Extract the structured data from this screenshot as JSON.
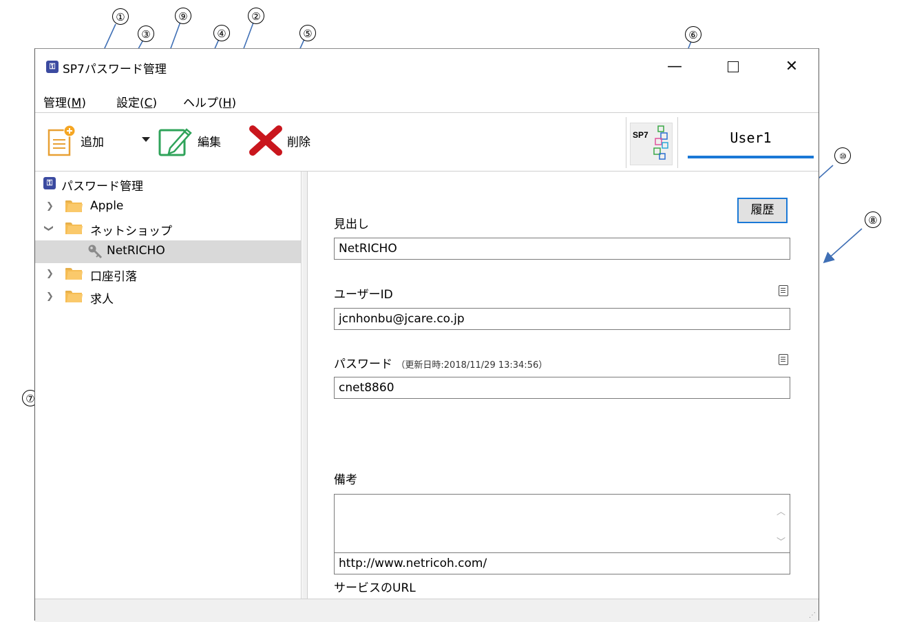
{
  "window": {
    "title": "SP7パスワード管理",
    "app_icon": "password-manager-icon",
    "minimize_icon": "—",
    "close_icon": "✕"
  },
  "menu": {
    "items": [
      {
        "label": "管理(",
        "key": "M",
        "end": ")"
      },
      {
        "label": "設定(",
        "key": "C",
        "end": ")"
      },
      {
        "label": "ヘルプ(",
        "key": "H",
        "end": ")"
      }
    ]
  },
  "toolbar": {
    "add_label": "追加",
    "edit_label": "編集",
    "delete_label": "削除",
    "logo_text": "SP7",
    "user_name": "User1"
  },
  "tree": {
    "root": "パスワード管理",
    "items": [
      {
        "label": "Apple",
        "expanded": false
      },
      {
        "label": "ネットショップ",
        "expanded": true
      },
      {
        "label": "NetRICHO",
        "selected": true
      },
      {
        "label": "口座引落",
        "expanded": false
      },
      {
        "label": "求人",
        "expanded": false
      }
    ]
  },
  "detail": {
    "history_button": "履歴",
    "heading_label": "見出し",
    "heading_value": "NetRICHO",
    "userid_label": "ユーザーID",
    "userid_value": "jcnhonbu@jcare.co.jp",
    "password_label": "パスワード",
    "password_updated": "（更新日時:2018/11/29 13:34:56）",
    "password_value": "cnet8860",
    "memo_label": "備考",
    "memo_value": "",
    "url_label": "サービスのURL",
    "url_value": "http://www.netricoh.com/"
  },
  "callouts": [
    "①",
    "②",
    "③",
    "④",
    "⑤",
    "⑥",
    "⑦",
    "⑧",
    "⑨",
    "⑩"
  ],
  "colors": {
    "accent": "#1a78d6",
    "arrow": "#3f6fb5",
    "folder": "#f6bd54",
    "selection": "#d9d9d9"
  }
}
